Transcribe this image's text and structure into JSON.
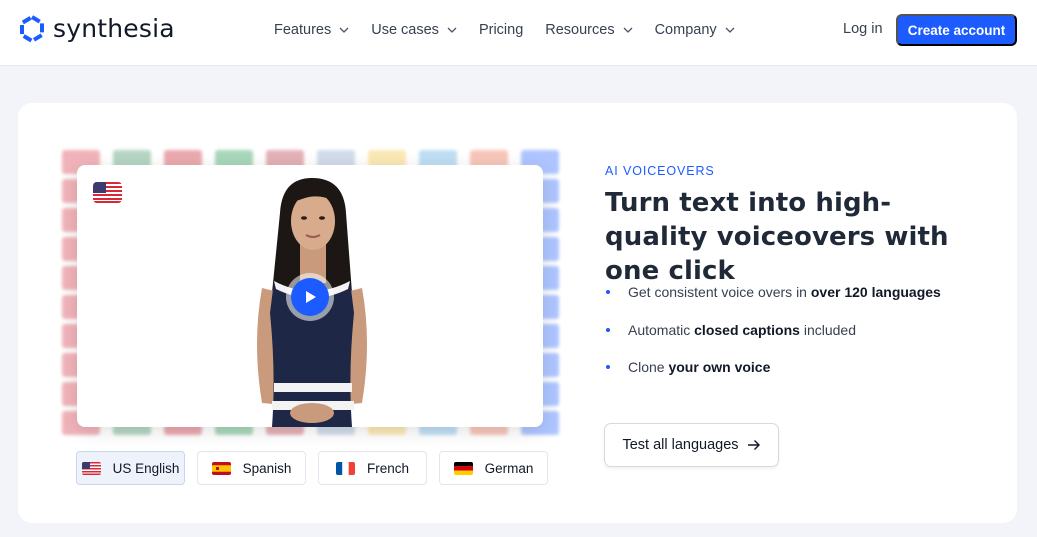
{
  "brand": {
    "name": "synthesia",
    "accent": "#1b5bff"
  },
  "nav": {
    "items": [
      {
        "label": "Features",
        "has_dropdown": true
      },
      {
        "label": "Use cases",
        "has_dropdown": true
      },
      {
        "label": "Pricing",
        "has_dropdown": false
      },
      {
        "label": "Resources",
        "has_dropdown": true
      },
      {
        "label": "Company",
        "has_dropdown": true
      }
    ],
    "login_label": "Log in",
    "cta_label": "Create account"
  },
  "hero": {
    "eyebrow": "AI VOICEOVERS",
    "headline": "Turn text into high-quality voiceovers with one click",
    "bullets": [
      {
        "pre": "Get consistent voice overs in ",
        "bold": "over 120 languages",
        "post": ""
      },
      {
        "pre": "Automatic ",
        "bold": "closed captions",
        "post": " included"
      },
      {
        "pre": "Clone ",
        "bold": "your own voice",
        "post": ""
      }
    ],
    "cta_label": "Test all languages",
    "cta_icon": "arrow-right-icon"
  },
  "video": {
    "current_language_flag": "us-flag-icon",
    "play_icon": "play-icon"
  },
  "languages": [
    {
      "label": "US English",
      "flag": "us",
      "active": true
    },
    {
      "label": "Spanish",
      "flag": "es",
      "active": false
    },
    {
      "label": "French",
      "flag": "fr",
      "active": false
    },
    {
      "label": "German",
      "flag": "de",
      "active": false
    }
  ]
}
